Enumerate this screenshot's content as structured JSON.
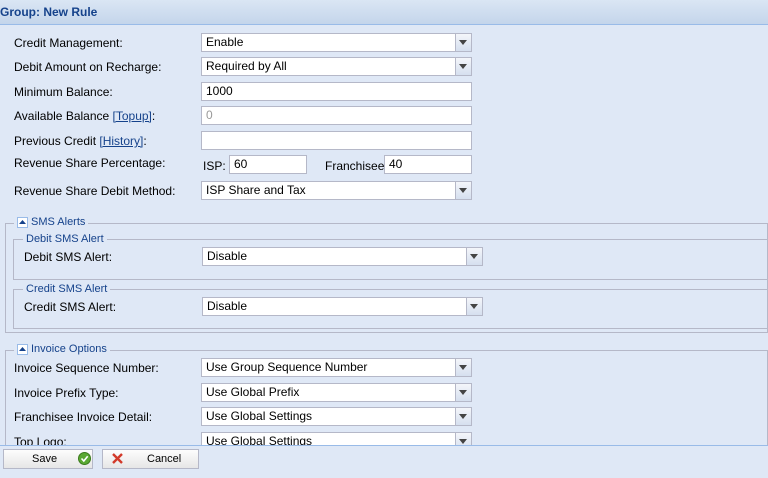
{
  "window": {
    "title": "Group: New Rule"
  },
  "credit": {
    "credit_management": {
      "label": "Credit Management:",
      "value": "Enable"
    },
    "debit_amount_on_recharge": {
      "label": "Debit Amount on Recharge:",
      "value": "Required by All"
    },
    "minimum_balance": {
      "label": "Minimum Balance:",
      "value": "1000"
    },
    "available_balance": {
      "label": "Available Balance",
      "link": "[Topup]",
      "colon": ":",
      "value": "0"
    },
    "previous_credit": {
      "label": "Previous Credit",
      "link": "[History]",
      "colon": ":",
      "value": ""
    },
    "revenue_share": {
      "label": "Revenue Share Percentage:",
      "isp_label": "ISP:",
      "isp_value": "60",
      "franchisee_label": "Franchisee:",
      "franchisee_value": "40"
    },
    "revenue_share_debit_method": {
      "label": "Revenue Share Debit Method:",
      "value": "ISP Share and Tax"
    }
  },
  "sms_alerts": {
    "title": "SMS Alerts",
    "debit": {
      "legend": "Debit SMS Alert",
      "label": "Debit SMS Alert:",
      "value": "Disable"
    },
    "credit": {
      "legend": "Credit SMS Alert",
      "label": "Credit SMS Alert:",
      "value": "Disable"
    }
  },
  "invoice_options": {
    "title": "Invoice Options",
    "sequence_number": {
      "label": "Invoice Sequence Number:",
      "value": "Use Group Sequence Number"
    },
    "prefix_type": {
      "label": "Invoice Prefix Type:",
      "value": "Use Global Prefix"
    },
    "franchisee_detail": {
      "label": "Franchisee Invoice Detail:",
      "value": "Use Global Settings"
    },
    "top_logo": {
      "label": "Top Logo:",
      "value": "Use Global Settings"
    }
  },
  "footer": {
    "save_label": "Save",
    "cancel_label": "Cancel"
  },
  "colors": {
    "accent": "#15428b",
    "panel_bg": "#dfe8f6",
    "border": "#99bbe8"
  },
  "icons": {
    "save": "check-circle-icon",
    "cancel": "x-icon",
    "combo": "chevron-down-icon",
    "collapse": "chevron-up-icon"
  }
}
